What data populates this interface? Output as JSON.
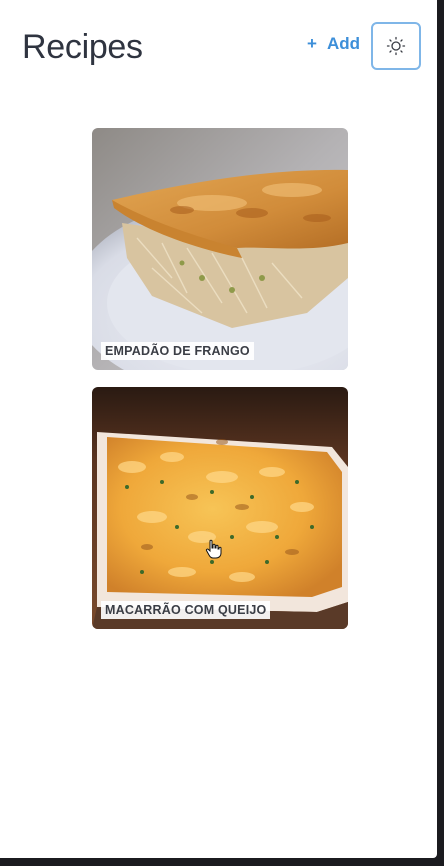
{
  "header": {
    "title": "Recipes",
    "add_plus": "+",
    "add_label": "Add",
    "theme_icon": "sun-icon"
  },
  "recipes": [
    {
      "name": "EMPADÃO DE FRANGO",
      "image": "chicken-pie-photo"
    },
    {
      "name": "MACARRÃO COM QUEIJO",
      "image": "mac-and-cheese-photo"
    }
  ],
  "colors": {
    "accent": "#3d8fd9",
    "title": "#2f3440",
    "theme_border": "#7fb6e8"
  }
}
